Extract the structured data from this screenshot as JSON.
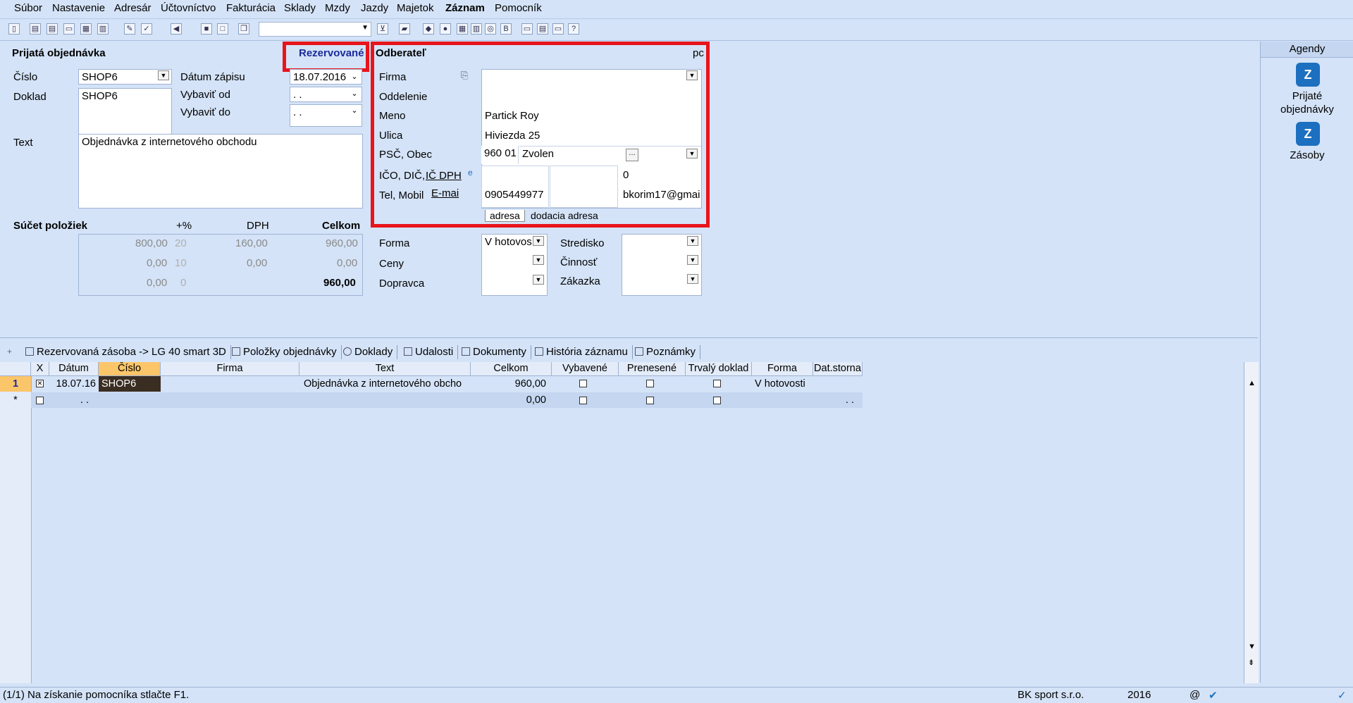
{
  "menu": [
    "Súbor",
    "Nastavenie",
    "Adresár",
    "Účtovníctvo",
    "Fakturácia",
    "Sklady",
    "Mzdy",
    "Jazdy",
    "Majetok",
    "Záznam",
    "Pomocník"
  ],
  "form": {
    "title": "Prijatá objednávka",
    "status": "Rezervované",
    "cislo_label": "Číslo",
    "cislo": "SHOP6",
    "doklad_label": "Doklad",
    "doklad": "SHOP6",
    "datum_zapisu_label": "Dátum zápisu",
    "datum_zapisu": "18.07.2016",
    "vybavit_od_label": "Vybaviť od",
    "vybavit_od": ". .",
    "vybavit_do_label": "Vybaviť do",
    "vybavit_do": ". .",
    "text_label": "Text",
    "text": "Objednávka z internetového obchodu",
    "sucet": {
      "label": "Súčet položiek",
      "h_pct": "+%",
      "h_dph": "DPH",
      "h_celkom": "Celkom",
      "rows": [
        {
          "zaklad": "800,00",
          "pct": "20",
          "dph": "160,00",
          "celkom": "960,00"
        },
        {
          "zaklad": "0,00",
          "pct": "10",
          "dph": "0,00",
          "celkom": "0,00"
        },
        {
          "zaklad": "0,00",
          "pct": "0",
          "dph": "",
          "celkom": "960,00"
        }
      ]
    }
  },
  "odberatel": {
    "title": "Odberateľ",
    "corner": "pc",
    "firma_label": "Firma",
    "firma": "",
    "oddelenie_label": "Oddelenie",
    "meno_label": "Meno",
    "meno": "Partick Roy",
    "ulica_label": "Ulica",
    "ulica": "Hiviezda 25",
    "psc_label": "PSČ, Obec",
    "psc": "960 01",
    "obec": "Zvolen",
    "ico_label": "IČO, DIČ,",
    "icdph_link": "IČ DPH",
    "icdph_value": "0",
    "tel_label": "Tel, Mobil",
    "email_link": "E-mai",
    "tel": "0905449977",
    "email": "bkorim17@gmai",
    "tab_adresa": "adresa",
    "tab_dodacia": "dodacia adresa"
  },
  "payment": {
    "forma_label": "Forma",
    "forma": "V hotovos",
    "ceny_label": "Ceny",
    "dopravca_label": "Dopravca",
    "stredisko_label": "Stredisko",
    "cinnost_label": "Činnosť",
    "zakazka_label": "Zákazka"
  },
  "agendy": {
    "title": "Agendy",
    "items": [
      {
        "label1": "Prijaté",
        "label2": "objednávky",
        "icon": "z-icon"
      },
      {
        "label1": "Zásoby",
        "label2": "",
        "icon": "z-icon"
      }
    ]
  },
  "tabs": [
    "Rezervovaná zásoba -> LG 40 smart 3D",
    "Položky objednávky",
    "Doklady",
    "Udalosti",
    "Dokumenty",
    "História záznamu",
    "Poznámky"
  ],
  "grid": {
    "headers": [
      "X",
      "Dátum",
      "Číslo",
      "Firma",
      "Text",
      "Celkom",
      "Vybavené",
      "Prenesené",
      "Trvalý doklad",
      "Forma",
      "Dat.storna"
    ],
    "row1": {
      "num": "1",
      "datum": "18.07.16",
      "cislo": "SHOP6",
      "firma": "",
      "text": "Objednávka z internetového obcho",
      "celkom": "960,00",
      "forma": "V hotovosti"
    },
    "row2": {
      "num": "*",
      "datum": ". .",
      "celkom": "0,00",
      "storna": ". ."
    }
  },
  "status": {
    "left": "(1/1) Na získanie pomocníka stlačte F1.",
    "company": "BK sport  s.r.o.",
    "year": "2016",
    "at": "@"
  }
}
